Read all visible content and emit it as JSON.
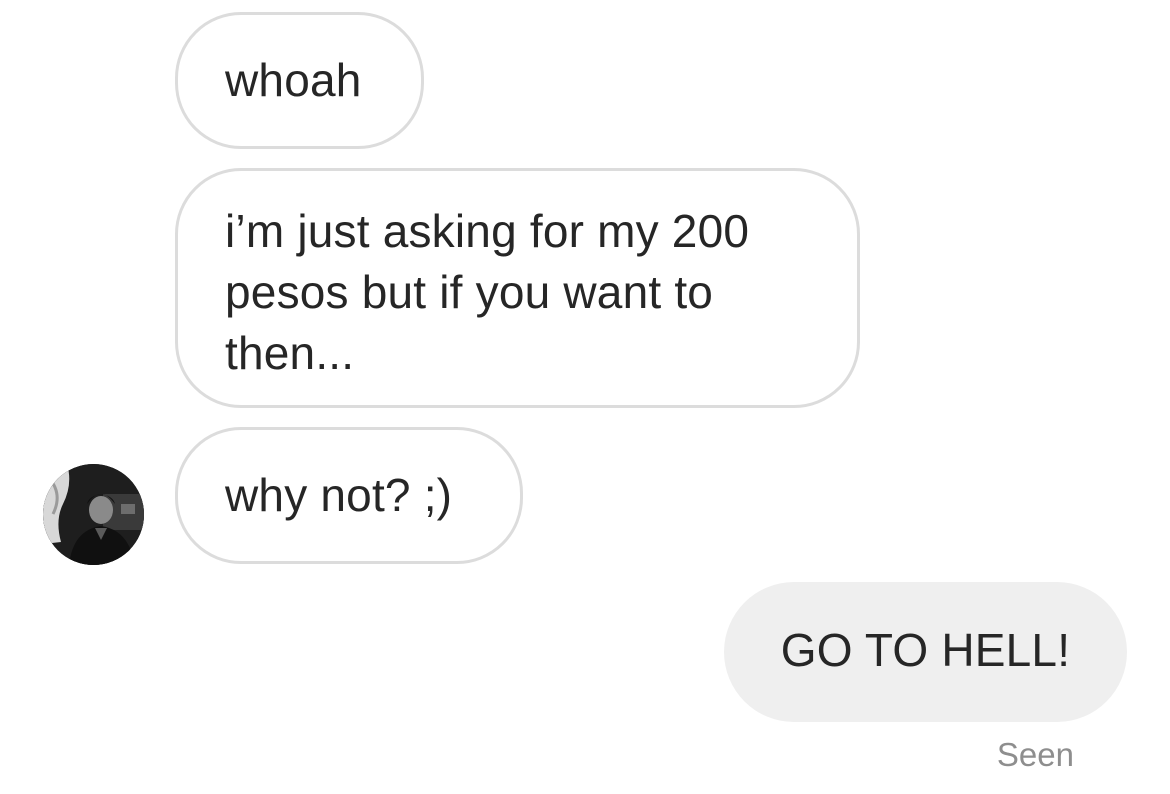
{
  "conversation": {
    "messages": [
      {
        "direction": "incoming",
        "text": "whoah"
      },
      {
        "direction": "incoming",
        "text": "i’m just asking for my 200 pesos but if you want to then..."
      },
      {
        "direction": "incoming",
        "text": "why not? ;)"
      },
      {
        "direction": "outgoing",
        "text": "GO TO HELL!"
      }
    ],
    "status": "Seen"
  },
  "colors": {
    "incoming_bubble_border": "#dcdcdc",
    "outgoing_bubble_fill": "#efefef",
    "text": "#262626",
    "status_text": "#8e8e8e"
  },
  "icons": {
    "sender_avatar": "profile-photo"
  }
}
